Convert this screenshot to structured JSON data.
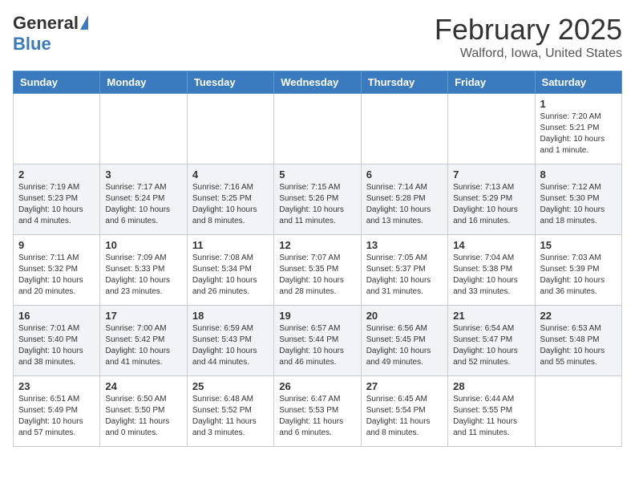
{
  "header": {
    "logo_general": "General",
    "logo_blue": "Blue",
    "month_title": "February 2025",
    "location": "Walford, Iowa, United States"
  },
  "days_of_week": [
    "Sunday",
    "Monday",
    "Tuesday",
    "Wednesday",
    "Thursday",
    "Friday",
    "Saturday"
  ],
  "weeks": [
    [
      {
        "day": "",
        "info": ""
      },
      {
        "day": "",
        "info": ""
      },
      {
        "day": "",
        "info": ""
      },
      {
        "day": "",
        "info": ""
      },
      {
        "day": "",
        "info": ""
      },
      {
        "day": "",
        "info": ""
      },
      {
        "day": "1",
        "info": "Sunrise: 7:20 AM\nSunset: 5:21 PM\nDaylight: 10 hours and 1 minute."
      }
    ],
    [
      {
        "day": "2",
        "info": "Sunrise: 7:19 AM\nSunset: 5:23 PM\nDaylight: 10 hours and 4 minutes."
      },
      {
        "day": "3",
        "info": "Sunrise: 7:17 AM\nSunset: 5:24 PM\nDaylight: 10 hours and 6 minutes."
      },
      {
        "day": "4",
        "info": "Sunrise: 7:16 AM\nSunset: 5:25 PM\nDaylight: 10 hours and 8 minutes."
      },
      {
        "day": "5",
        "info": "Sunrise: 7:15 AM\nSunset: 5:26 PM\nDaylight: 10 hours and 11 minutes."
      },
      {
        "day": "6",
        "info": "Sunrise: 7:14 AM\nSunset: 5:28 PM\nDaylight: 10 hours and 13 minutes."
      },
      {
        "day": "7",
        "info": "Sunrise: 7:13 AM\nSunset: 5:29 PM\nDaylight: 10 hours and 16 minutes."
      },
      {
        "day": "8",
        "info": "Sunrise: 7:12 AM\nSunset: 5:30 PM\nDaylight: 10 hours and 18 minutes."
      }
    ],
    [
      {
        "day": "9",
        "info": "Sunrise: 7:11 AM\nSunset: 5:32 PM\nDaylight: 10 hours and 20 minutes."
      },
      {
        "day": "10",
        "info": "Sunrise: 7:09 AM\nSunset: 5:33 PM\nDaylight: 10 hours and 23 minutes."
      },
      {
        "day": "11",
        "info": "Sunrise: 7:08 AM\nSunset: 5:34 PM\nDaylight: 10 hours and 26 minutes."
      },
      {
        "day": "12",
        "info": "Sunrise: 7:07 AM\nSunset: 5:35 PM\nDaylight: 10 hours and 28 minutes."
      },
      {
        "day": "13",
        "info": "Sunrise: 7:05 AM\nSunset: 5:37 PM\nDaylight: 10 hours and 31 minutes."
      },
      {
        "day": "14",
        "info": "Sunrise: 7:04 AM\nSunset: 5:38 PM\nDaylight: 10 hours and 33 minutes."
      },
      {
        "day": "15",
        "info": "Sunrise: 7:03 AM\nSunset: 5:39 PM\nDaylight: 10 hours and 36 minutes."
      }
    ],
    [
      {
        "day": "16",
        "info": "Sunrise: 7:01 AM\nSunset: 5:40 PM\nDaylight: 10 hours and 38 minutes."
      },
      {
        "day": "17",
        "info": "Sunrise: 7:00 AM\nSunset: 5:42 PM\nDaylight: 10 hours and 41 minutes."
      },
      {
        "day": "18",
        "info": "Sunrise: 6:59 AM\nSunset: 5:43 PM\nDaylight: 10 hours and 44 minutes."
      },
      {
        "day": "19",
        "info": "Sunrise: 6:57 AM\nSunset: 5:44 PM\nDaylight: 10 hours and 46 minutes."
      },
      {
        "day": "20",
        "info": "Sunrise: 6:56 AM\nSunset: 5:45 PM\nDaylight: 10 hours and 49 minutes."
      },
      {
        "day": "21",
        "info": "Sunrise: 6:54 AM\nSunset: 5:47 PM\nDaylight: 10 hours and 52 minutes."
      },
      {
        "day": "22",
        "info": "Sunrise: 6:53 AM\nSunset: 5:48 PM\nDaylight: 10 hours and 55 minutes."
      }
    ],
    [
      {
        "day": "23",
        "info": "Sunrise: 6:51 AM\nSunset: 5:49 PM\nDaylight: 10 hours and 57 minutes."
      },
      {
        "day": "24",
        "info": "Sunrise: 6:50 AM\nSunset: 5:50 PM\nDaylight: 11 hours and 0 minutes."
      },
      {
        "day": "25",
        "info": "Sunrise: 6:48 AM\nSunset: 5:52 PM\nDaylight: 11 hours and 3 minutes."
      },
      {
        "day": "26",
        "info": "Sunrise: 6:47 AM\nSunset: 5:53 PM\nDaylight: 11 hours and 6 minutes."
      },
      {
        "day": "27",
        "info": "Sunrise: 6:45 AM\nSunset: 5:54 PM\nDaylight: 11 hours and 8 minutes."
      },
      {
        "day": "28",
        "info": "Sunrise: 6:44 AM\nSunset: 5:55 PM\nDaylight: 11 hours and 11 minutes."
      },
      {
        "day": "",
        "info": ""
      }
    ]
  ]
}
